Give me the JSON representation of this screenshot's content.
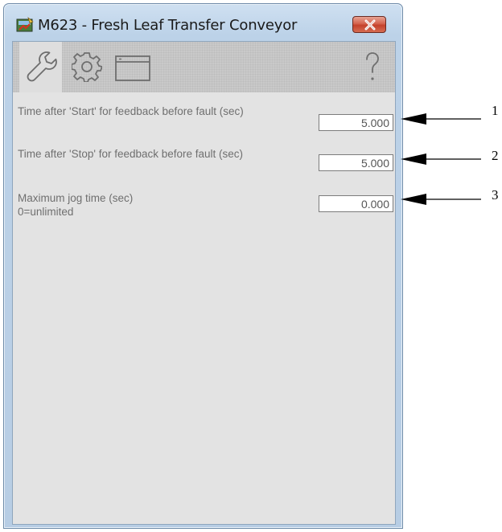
{
  "window": {
    "title": "M623 - Fresh Leaf Transfer Conveyor",
    "close_icon": "close-x-icon"
  },
  "toolbar": {
    "tabs": [
      {
        "icon": "wrench-icon",
        "active": true
      },
      {
        "icon": "gear-icon",
        "active": false
      },
      {
        "icon": "window-icon",
        "active": false
      },
      {
        "icon": "help-icon",
        "label": "?"
      }
    ]
  },
  "settings": [
    {
      "label": "Time after 'Start' for feedback before fault (sec)",
      "value": "5.000"
    },
    {
      "label": "Time after 'Stop' for feedback before fault (sec)",
      "value": "5.000"
    },
    {
      "label": "Maximum jog time (sec)\n0=unlimited",
      "label_line1": "Maximum jog time (sec)",
      "label_line2": "0=unlimited",
      "value": "0.000"
    }
  ],
  "callouts": [
    "1",
    "2",
    "3"
  ],
  "colors": {
    "close_button": "#c9432d",
    "client_background": "#e3e3e3",
    "toolbar_background": "#c9c9c9",
    "frame": "#b7cde4"
  }
}
